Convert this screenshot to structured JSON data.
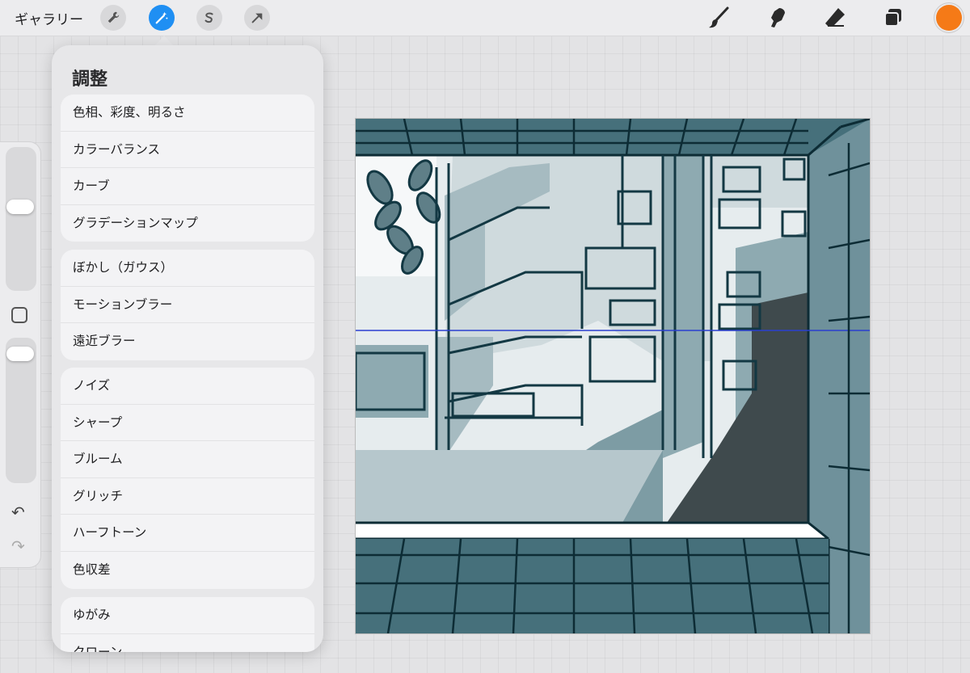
{
  "topbar": {
    "gallery_label": "ギャラリー",
    "left_tools": [
      {
        "icon": "wrench-icon",
        "name": "actions"
      },
      {
        "icon": "magic-wand-icon",
        "name": "adjustments",
        "active": true
      },
      {
        "icon": "selection-icon",
        "name": "selection"
      },
      {
        "icon": "transform-arrow-icon",
        "name": "transform"
      }
    ],
    "right_tools": [
      "brush-icon",
      "smudge-icon",
      "eraser-icon",
      "layers-icon"
    ],
    "current_color": "#f57a17",
    "accent_color": "#1f8ff3"
  },
  "sidebar": {
    "brush_size_level": 0.6,
    "opacity_level": 0.95
  },
  "adjustments": {
    "title": "調整",
    "groups": [
      {
        "items": [
          "色相、彩度、明るさ",
          "カラーバランス",
          "カーブ",
          "グラデーションマップ"
        ]
      },
      {
        "items": [
          "ぼかし（ガウス）",
          "モーションブラー",
          "遠近ブラー"
        ]
      },
      {
        "items": [
          "ノイズ",
          "シャープ",
          "ブルーム",
          "グリッチ",
          "ハーフトーン",
          "色収差"
        ]
      },
      {
        "items": [
          "ゆがみ",
          "クローン"
        ]
      }
    ]
  },
  "canvas": {
    "palette": {
      "dark": "#2f5a66",
      "mid": "#6f919b",
      "light": "#aabec4",
      "line": "#133843",
      "pale": "#e6ecee",
      "guide": "#2a3fd0"
    }
  }
}
